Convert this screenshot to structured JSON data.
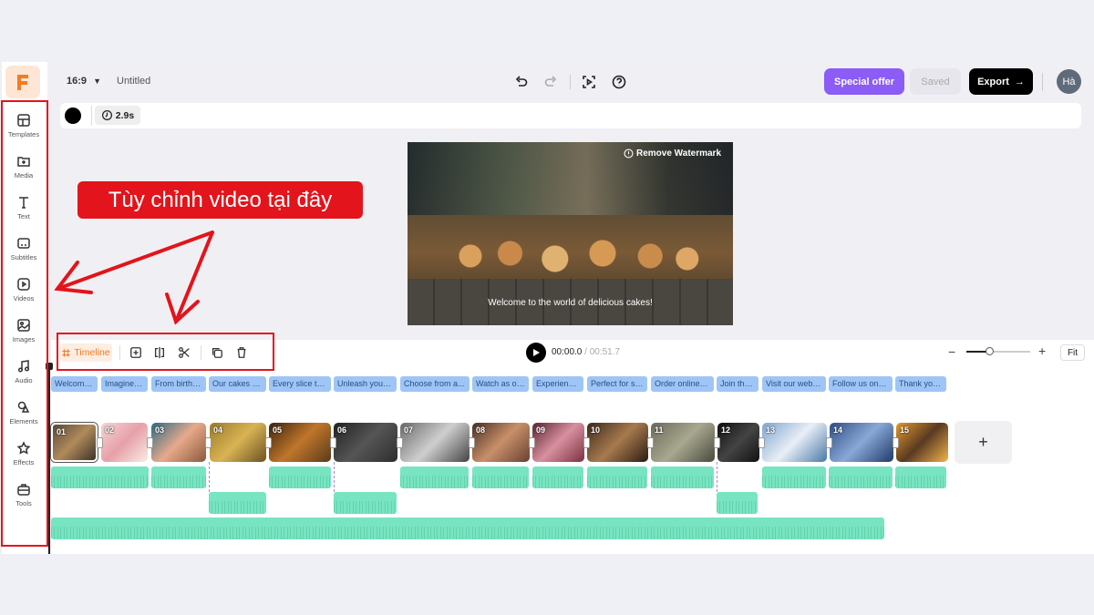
{
  "app": {
    "project_title": "Untitled",
    "aspect_ratio": "16:9"
  },
  "header": {
    "special_offer": "Special offer",
    "saved": "Saved",
    "export": "Export",
    "avatar": "Hà"
  },
  "properties": {
    "duration": "2.9s",
    "color": "#000000"
  },
  "sidebar": {
    "items": [
      {
        "label": "Templates",
        "icon": "templates-icon"
      },
      {
        "label": "Media",
        "icon": "media-icon"
      },
      {
        "label": "Text",
        "icon": "text-icon"
      },
      {
        "label": "Subtitles",
        "icon": "subtitles-icon"
      },
      {
        "label": "Videos",
        "icon": "videos-icon"
      },
      {
        "label": "Images",
        "icon": "images-icon"
      },
      {
        "label": "Audio",
        "icon": "audio-icon"
      },
      {
        "label": "Elements",
        "icon": "elements-icon"
      },
      {
        "label": "Effects",
        "icon": "effects-icon"
      },
      {
        "label": "Tools",
        "icon": "tools-icon"
      }
    ]
  },
  "canvas": {
    "watermark": "Remove Watermark",
    "caption": "Welcome to the world of delicious cakes!"
  },
  "timeline": {
    "label": "Timeline",
    "current_time": "00:00.0",
    "separator": "/",
    "total_time": "00:51.7",
    "fit": "Fit"
  },
  "subtitles": [
    "Welcome ...",
    "Imagine a...",
    "From birthd...",
    "Our cakes ar...",
    "Every slice tel...",
    "Unleash your ...",
    "Choose from a...",
    "Watch as ou...",
    "Experience...",
    "Perfect for sh...",
    "Order online f...",
    "Join the ...",
    "Visit our webs...",
    "Follow us on s...",
    "Thank you ..."
  ],
  "clips": [
    "01",
    "02",
    "03",
    "04",
    "05",
    "06",
    "07",
    "08",
    "09",
    "10",
    "11",
    "12",
    "13",
    "14",
    "15"
  ],
  "add_clip": "+",
  "annotation": {
    "callout": "Tùy chỉnh video tại đây"
  },
  "colors": {
    "accent": "#8b5cf6",
    "annotation_red": "#e3141b",
    "wave": "#78e4c1",
    "subtitle": "#9ec5f5",
    "logo": "#f47b20"
  }
}
